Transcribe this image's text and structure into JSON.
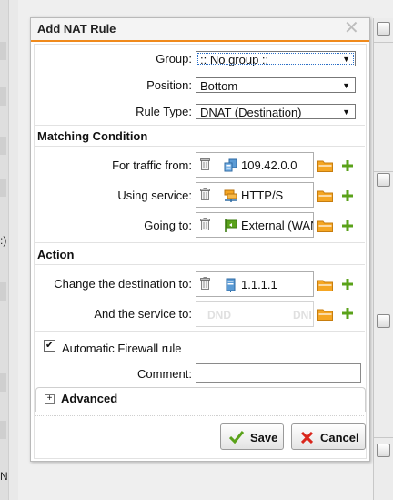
{
  "dialog": {
    "title": "Add NAT Rule",
    "close_glyph": "✕"
  },
  "fields": {
    "group": {
      "label": "Group:",
      "value": ":: No group ::"
    },
    "position": {
      "label": "Position:",
      "value": "Bottom"
    },
    "rule_type": {
      "label": "Rule Type:",
      "value": "DNAT (Destination)"
    }
  },
  "matching": {
    "title": "Matching Condition",
    "traffic_from": {
      "label": "For traffic from:",
      "value": "109.42.0.0",
      "icon": "network-icon"
    },
    "service": {
      "label": "Using service:",
      "value": "HTTP/S",
      "icon": "service-group-icon"
    },
    "going_to": {
      "label": "Going to:",
      "value": "External (WAN",
      "icon": "interface-flag-icon"
    }
  },
  "action": {
    "title": "Action",
    "change_destination": {
      "label": "Change the destination to:",
      "value": "1.1.1.1",
      "icon": "host-icon"
    },
    "and_service": {
      "label": "And the service to:",
      "placeholder": "DND",
      "placeholder_right": "DNI"
    }
  },
  "firewall": {
    "label": "Automatic Firewall rule",
    "checked": true,
    "check_glyph": "✔"
  },
  "comment": {
    "label": "Comment:",
    "value": ""
  },
  "advanced": {
    "label": "Advanced",
    "expander": "+"
  },
  "buttons": {
    "save": "Save",
    "cancel": "Cancel"
  },
  "background": {
    "left_fragment_1": ":)",
    "left_fragment_2": "N"
  },
  "colors": {
    "accent": "#f08a1c",
    "add_green": "#5aa21a",
    "cancel_red": "#d9261c",
    "folder_orange": "#f5a623"
  }
}
